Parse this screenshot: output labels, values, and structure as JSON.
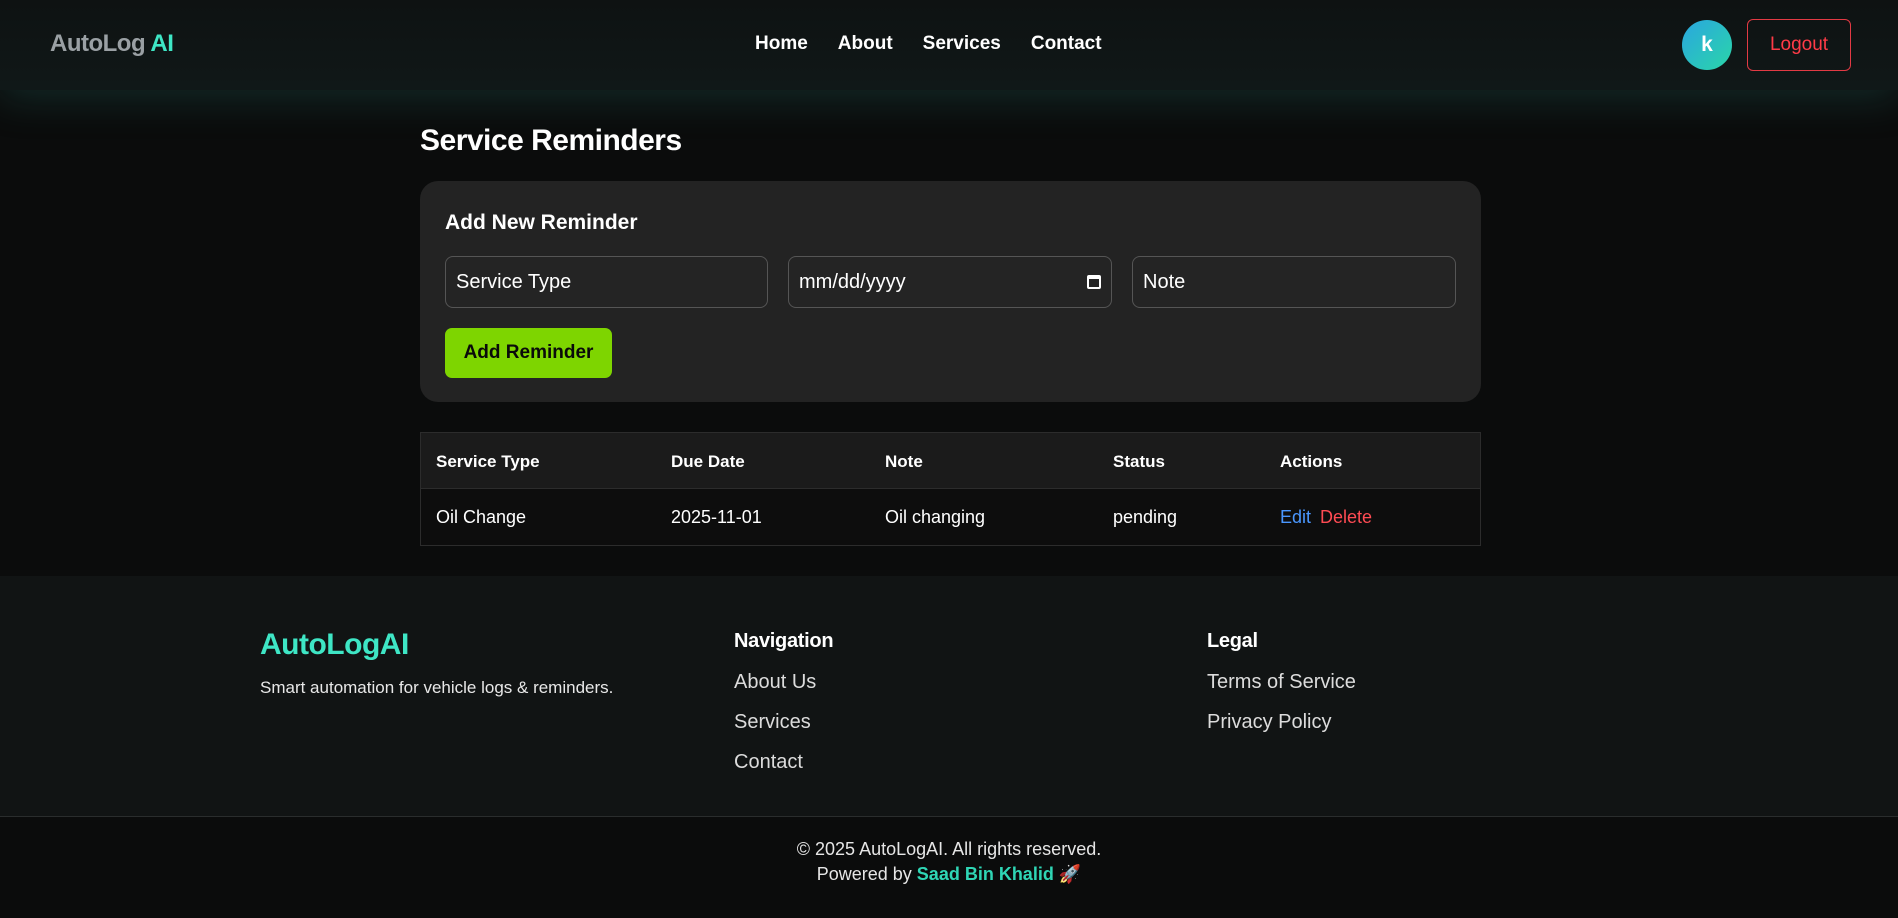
{
  "navbar": {
    "brand_part1": "AutoLog",
    "brand_part2": "AI",
    "links": [
      "Home",
      "About",
      "Services",
      "Contact"
    ],
    "avatar_initial": "k",
    "logout_label": "Logout"
  },
  "main": {
    "title": "Service Reminders",
    "form": {
      "title": "Add New Reminder",
      "service_type_placeholder": "Service Type",
      "date_placeholder": "mm/dd/yyyy",
      "note_placeholder": "Note",
      "submit_label": "Add Reminder"
    },
    "table": {
      "headers": [
        "Service Type",
        "Due Date",
        "Note",
        "Status",
        "Actions"
      ],
      "rows": [
        {
          "service_type": "Oil Change",
          "due_date": "2025-11-01",
          "note": "Oil changing",
          "status": "pending",
          "edit_label": "Edit",
          "delete_label": "Delete"
        }
      ]
    }
  },
  "footer": {
    "brand": "AutoLogAI",
    "tagline": "Smart automation for vehicle logs & reminders.",
    "navigation": {
      "title": "Navigation",
      "links": [
        "About Us",
        "Services",
        "Contact"
      ]
    },
    "legal": {
      "title": "Legal",
      "links": [
        "Terms of Service",
        "Privacy Policy"
      ]
    },
    "copyright": "© 2025 AutoLogAI. All rights reserved.",
    "powered_prefix": "Powered by ",
    "author": "Saad Bin Khalid",
    "powered_suffix": " 🚀"
  },
  "colors": {
    "accent": "#3ee6c5",
    "primary_button": "#7ed500",
    "logout": "#ff3b47",
    "edit": "#4a97ff",
    "delete": "#ff4b53"
  }
}
